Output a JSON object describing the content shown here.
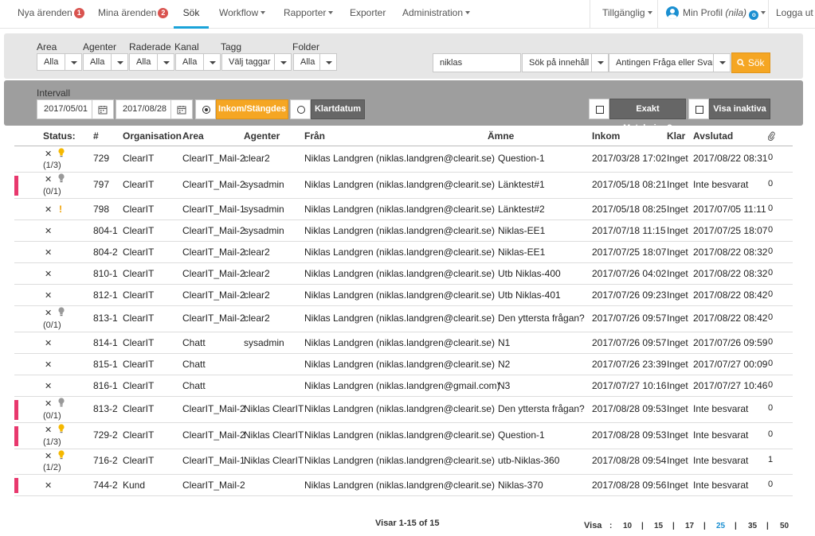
{
  "topnav": {
    "items": [
      {
        "label": "Nya ärenden",
        "badge": "1"
      },
      {
        "label": "Mina ärenden",
        "badge": "2"
      },
      {
        "label": "Sök"
      },
      {
        "label": "Workflow"
      },
      {
        "label": "Rapporter"
      },
      {
        "label": "Exporter"
      },
      {
        "label": "Administration"
      }
    ],
    "status": "Tillgänglig",
    "profile": "Min Profil",
    "profile_user": "(nila)",
    "profile_badge": "o",
    "logout": "Logga ut"
  },
  "filters": {
    "area": {
      "label": "Area",
      "value": "Alla"
    },
    "agenter": {
      "label": "Agenter",
      "value": "Alla"
    },
    "raderade": {
      "label": "Raderade",
      "value": "Alla"
    },
    "kanal": {
      "label": "Kanal",
      "value": "Alla"
    },
    "tagg": {
      "label": "Tagg",
      "value": "Välj taggar"
    },
    "folder": {
      "label": "Folder",
      "value": "Alla"
    },
    "search_value": "niklas",
    "search_scope": "Sök på innehåll",
    "search_type": "Antingen Fråga eller Svar",
    "search_button": "Sök"
  },
  "interval": {
    "label": "Intervall",
    "from": "2017/05/01",
    "to": "2017/08/28",
    "mode_inkom": "Inkom/Stängdes",
    "mode_klart": "Klartdatum",
    "exakt": "Exakt Matchning?",
    "inaktiva": "Visa inaktiva"
  },
  "table": {
    "headers": {
      "status": "Status:",
      "num": "#",
      "org": "Organisation",
      "area": "Area",
      "agent": "Agenter",
      "from": "Från",
      "subject": "Ämne",
      "inkom": "Inkom",
      "klar": "Klar",
      "avslutad": "Avslutad"
    },
    "rows": [
      {
        "flag": false,
        "icon": "bulb-yellow",
        "frac": "(1/3)",
        "num": "729",
        "org": "ClearIT",
        "area": "ClearIT_Mail-2",
        "agent": "clear2",
        "from": "Niklas Landgren (niklas.landgren@clearit.se)",
        "subject": "Question-1",
        "inkom": "2017/03/28 17:02",
        "klar": "Inget",
        "avslutad": "2017/08/22 08:31",
        "att": "0"
      },
      {
        "flag": true,
        "icon": "bulb-gray",
        "frac": "(0/1)",
        "num": "797",
        "org": "ClearIT",
        "area": "ClearIT_Mail-2",
        "agent": "sysadmin",
        "from": "Niklas Landgren (niklas.landgren@clearit.se)",
        "subject": "Länktest#1",
        "inkom": "2017/05/18 08:21",
        "klar": "Inget",
        "avslutad": "Inte besvarat",
        "att": "0"
      },
      {
        "flag": false,
        "icon": "exclamation",
        "frac": "",
        "num": "798",
        "org": "ClearIT",
        "area": "ClearIT_Mail-1",
        "agent": "sysadmin",
        "from": "Niklas Landgren (niklas.landgren@clearit.se)",
        "subject": "Länktest#2",
        "inkom": "2017/05/18 08:25",
        "klar": "Inget",
        "avslutad": "2017/07/05 11:11",
        "att": "0"
      },
      {
        "flag": false,
        "icon": "",
        "frac": "",
        "num": "804-1",
        "org": "ClearIT",
        "area": "ClearIT_Mail-2",
        "agent": "sysadmin",
        "from": "Niklas Landgren (niklas.landgren@clearit.se)",
        "subject": "Niklas-EE1",
        "inkom": "2017/07/18 11:15",
        "klar": "Inget",
        "avslutad": "2017/07/25 18:07",
        "att": "0"
      },
      {
        "flag": false,
        "icon": "",
        "frac": "",
        "num": "804-2",
        "org": "ClearIT",
        "area": "ClearIT_Mail-2",
        "agent": "clear2",
        "from": "Niklas Landgren (niklas.landgren@clearit.se)",
        "subject": "Niklas-EE1",
        "inkom": "2017/07/25 18:07",
        "klar": "Inget",
        "avslutad": "2017/08/22 08:32",
        "att": "0"
      },
      {
        "flag": false,
        "icon": "",
        "frac": "",
        "num": "810-1",
        "org": "ClearIT",
        "area": "ClearIT_Mail-2",
        "agent": "clear2",
        "from": "Niklas Landgren (niklas.landgren@clearit.se)",
        "subject": "Utb Niklas-400",
        "inkom": "2017/07/26 04:02",
        "klar": "Inget",
        "avslutad": "2017/08/22 08:32",
        "att": "0"
      },
      {
        "flag": false,
        "icon": "",
        "frac": "",
        "num": "812-1",
        "org": "ClearIT",
        "area": "ClearIT_Mail-2",
        "agent": "clear2",
        "from": "Niklas Landgren (niklas.landgren@clearit.se)",
        "subject": "Utb Niklas-401",
        "inkom": "2017/07/26 09:23",
        "klar": "Inget",
        "avslutad": "2017/08/22 08:42",
        "att": "0"
      },
      {
        "flag": false,
        "icon": "bulb-gray",
        "frac": "(0/1)",
        "num": "813-1",
        "org": "ClearIT",
        "area": "ClearIT_Mail-2",
        "agent": "clear2",
        "from": "Niklas Landgren (niklas.landgren@clearit.se)",
        "subject": "Den yttersta frågan?",
        "inkom": "2017/07/26 09:57",
        "klar": "Inget",
        "avslutad": "2017/08/22 08:42",
        "att": "0"
      },
      {
        "flag": false,
        "icon": "",
        "frac": "",
        "num": "814-1",
        "org": "ClearIT",
        "area": "Chatt",
        "agent": "sysadmin",
        "from": "Niklas Landgren (niklas.landgren@clearit.se)",
        "subject": "N1",
        "inkom": "2017/07/26 09:57",
        "klar": "Inget",
        "avslutad": "2017/07/26 09:59",
        "att": "0"
      },
      {
        "flag": false,
        "icon": "",
        "frac": "",
        "num": "815-1",
        "org": "ClearIT",
        "area": "Chatt",
        "agent": "",
        "from": "Niklas Landgren (niklas.landgren@clearit.se)",
        "subject": "N2",
        "inkom": "2017/07/26 23:39",
        "klar": "Inget",
        "avslutad": "2017/07/27 00:09",
        "att": "0"
      },
      {
        "flag": false,
        "icon": "",
        "frac": "",
        "num": "816-1",
        "org": "ClearIT",
        "area": "Chatt",
        "agent": "",
        "from": "Niklas Landgren (niklas.landgren@gmail.com)",
        "subject": "N3",
        "inkom": "2017/07/27 10:16",
        "klar": "Inget",
        "avslutad": "2017/07/27 10:46",
        "att": "0"
      },
      {
        "flag": true,
        "icon": "bulb-gray",
        "frac": "(0/1)",
        "num": "813-2",
        "org": "ClearIT",
        "area": "ClearIT_Mail-2",
        "agent": "Niklas ClearIT",
        "from": "Niklas Landgren (niklas.landgren@clearit.se)",
        "subject": "Den yttersta frågan?",
        "inkom": "2017/08/28 09:53",
        "klar": "Inget",
        "avslutad": "Inte besvarat",
        "att": "0"
      },
      {
        "flag": true,
        "icon": "bulb-yellow",
        "frac": "(1/3)",
        "num": "729-2",
        "org": "ClearIT",
        "area": "ClearIT_Mail-2",
        "agent": "Niklas ClearIT",
        "from": "Niklas Landgren (niklas.landgren@clearit.se)",
        "subject": "Question-1",
        "inkom": "2017/08/28 09:53",
        "klar": "Inget",
        "avslutad": "Inte besvarat",
        "att": "0"
      },
      {
        "flag": false,
        "icon": "bulb-yellow",
        "frac": "(1/2)",
        "num": "716-2",
        "org": "ClearIT",
        "area": "ClearIT_Mail-1",
        "agent": "Niklas ClearIT",
        "from": "Niklas Landgren (niklas.landgren@clearit.se)",
        "subject": "utb-Niklas-360",
        "inkom": "2017/08/28 09:54",
        "klar": "Inget",
        "avslutad": "Inte besvarat",
        "att": "1"
      },
      {
        "flag": true,
        "icon": "",
        "frac": "",
        "num": "744-2",
        "org": "Kund",
        "area": "ClearIT_Mail-2",
        "agent": "",
        "from": "Niklas Landgren (niklas.landgren@clearit.se)",
        "subject": "Niklas-370",
        "inkom": "2017/08/28 09:56",
        "klar": "Inget",
        "avslutad": "Inte besvarat",
        "att": "0"
      }
    ]
  },
  "footer": {
    "showing": "Visar 1-15 of 15",
    "visa": "Visa",
    "colon": ":",
    "sep": "|",
    "page_sizes": [
      "10",
      "15",
      "17",
      "25",
      "35",
      "50"
    ],
    "active_size": "25"
  },
  "colors": {
    "accent": "#f5a623",
    "brand": "#1a8fd1",
    "flag": "#e8386d"
  }
}
